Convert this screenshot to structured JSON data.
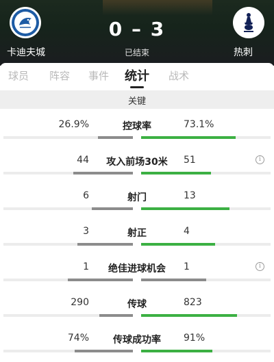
{
  "match": {
    "home_team": "卡迪夫城",
    "away_team": "热刺",
    "score": "0 – 3",
    "status": "已结束"
  },
  "tabs": [
    {
      "label": "球员",
      "active": false
    },
    {
      "label": "阵容",
      "active": false
    },
    {
      "label": "事件",
      "active": false
    },
    {
      "label": "统计",
      "active": true
    },
    {
      "label": "战术",
      "active": false
    }
  ],
  "section": {
    "title": "关键"
  },
  "colors": {
    "home_bar": "#8c8c8c",
    "away_bar_leading": "#3cb043",
    "away_bar_neutral": "#8c8c8c"
  },
  "stats": [
    {
      "label": "控球率",
      "home": "26.9%",
      "away": "73.1%",
      "home_share": 0.269,
      "away_share": 0.731,
      "info": false,
      "away_leads": true
    },
    {
      "label": "攻入前场30米",
      "home": "44",
      "away": "51",
      "home_share": 0.46,
      "away_share": 0.54,
      "info": true,
      "away_leads": true
    },
    {
      "label": "射门",
      "home": "6",
      "away": "13",
      "home_share": 0.32,
      "away_share": 0.68,
      "info": false,
      "away_leads": true
    },
    {
      "label": "射正",
      "home": "3",
      "away": "4",
      "home_share": 0.43,
      "away_share": 0.57,
      "info": false,
      "away_leads": true
    },
    {
      "label": "绝佳进球机会",
      "home": "1",
      "away": "1",
      "home_share": 0.5,
      "away_share": 0.5,
      "info": true,
      "away_leads": false
    },
    {
      "label": "传球",
      "home": "290",
      "away": "823",
      "home_share": 0.26,
      "away_share": 0.74,
      "info": false,
      "away_leads": true
    },
    {
      "label": "传球成功率",
      "home": "74%",
      "away": "91%",
      "home_share": 0.45,
      "away_share": 0.55,
      "info": false,
      "away_leads": true
    }
  ]
}
